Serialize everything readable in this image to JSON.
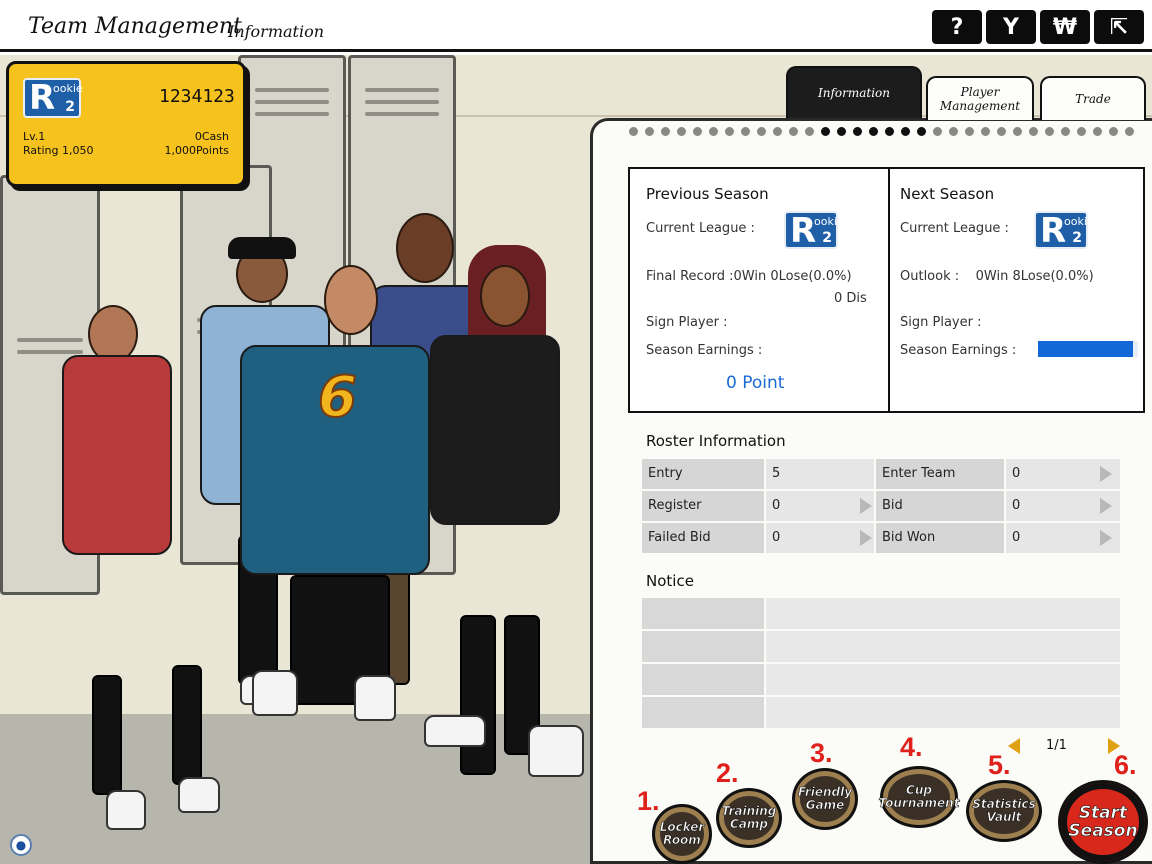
{
  "header": {
    "title": "Team Management",
    "subtitle": "Information",
    "buttons": [
      {
        "icon": "help-icon",
        "glyph": "?"
      },
      {
        "icon": "wrench-icon",
        "glyph": "Y"
      },
      {
        "icon": "currency-icon",
        "glyph": "₩"
      },
      {
        "icon": "exit-icon",
        "glyph": "⇱"
      }
    ]
  },
  "player_card": {
    "badge_letter": "R",
    "badge_text": "ookie",
    "badge_level": "2",
    "id": "1234123",
    "level": "Lv.1",
    "rating": "Rating 1,050",
    "cash": "0Cash",
    "points": "1,000Points"
  },
  "tabs": [
    {
      "label": "Information",
      "active": true
    },
    {
      "label": "Player Management",
      "active": false
    },
    {
      "label": "Trade",
      "active": false
    }
  ],
  "previous_season": {
    "title": "Previous Season",
    "current_league_label": "Current League :",
    "final_record": "Final Record :0Win 0Lose(0.0%)",
    "dis": "0 Dis",
    "sign_player_label": "Sign Player :",
    "season_earnings_label": "Season Earnings :",
    "earnings_value": "0 Point"
  },
  "next_season": {
    "title": "Next Season",
    "current_league_label": "Current League :",
    "outlook": "Outlook :    0Win 8Lose(0.0%)",
    "sign_player_label": "Sign Player :",
    "season_earnings_label": "Season Earnings :",
    "earnings_fill_fraction": 0.95
  },
  "roster": {
    "title": "Roster Information",
    "rows": [
      {
        "left_label": "Entry",
        "left_value": "5",
        "left_arrow": false,
        "right_label": "Enter Team",
        "right_value": "0"
      },
      {
        "left_label": "Register",
        "left_value": "0",
        "left_arrow": true,
        "right_label": "Bid",
        "right_value": "0"
      },
      {
        "left_label": "Failed Bid",
        "left_value": "0",
        "left_arrow": true,
        "right_label": "Bid Won",
        "right_value": "0"
      }
    ]
  },
  "notice": {
    "title": "Notice"
  },
  "pager": {
    "text": "1/1"
  },
  "menu": [
    {
      "num": "1.",
      "line1": "Locker",
      "line2": "Room"
    },
    {
      "num": "2.",
      "line1": "Training",
      "line2": "Camp"
    },
    {
      "num": "3.",
      "line1": "Friendly",
      "line2": "Game"
    },
    {
      "num": "4.",
      "line1": "Cup",
      "line2": "Tournament"
    },
    {
      "num": "5.",
      "line1": "Statistics",
      "line2": "Vault"
    },
    {
      "num": "6.",
      "line1": "Start",
      "line2": "Season"
    }
  ],
  "jersey_number": "6",
  "colors": {
    "card_yellow": "#f6c21d",
    "badge_blue": "#1f5fa8",
    "earnings_blue": "#1368d8",
    "start_red": "#d8281c",
    "number_red": "#e0201a"
  }
}
